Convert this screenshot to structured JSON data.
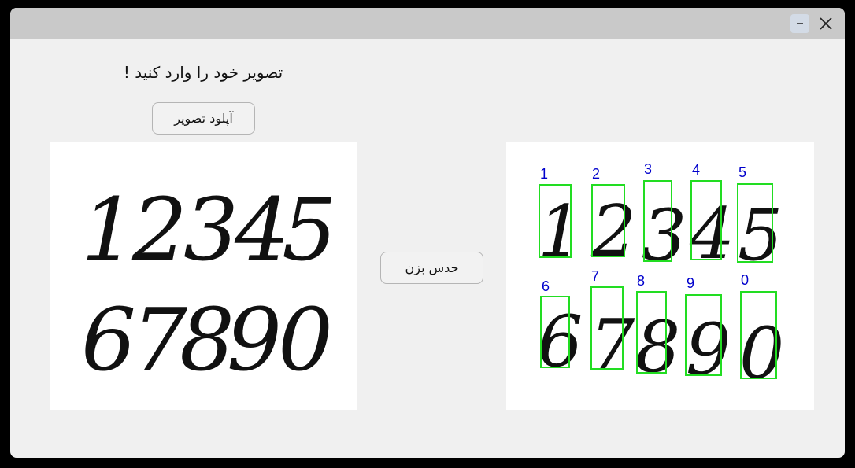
{
  "titlebar": {
    "minimize_icon": "minimize-icon",
    "close_icon": "close-icon"
  },
  "heading": "تصویر خود را وارد کنید !",
  "upload_button": "آپلود تصویر",
  "detect_button": "حدس بزن",
  "input_image": {
    "row1": [
      "1",
      "2",
      "3",
      "4",
      "5"
    ],
    "row2": [
      "6",
      "7",
      "8",
      "9",
      "0"
    ]
  },
  "output_image": {
    "box_color": "#22dd22",
    "label_color": "#0000cc",
    "labels": [
      "1",
      "2",
      "3",
      "4",
      "5",
      "6",
      "7",
      "8",
      "9",
      "0"
    ]
  }
}
